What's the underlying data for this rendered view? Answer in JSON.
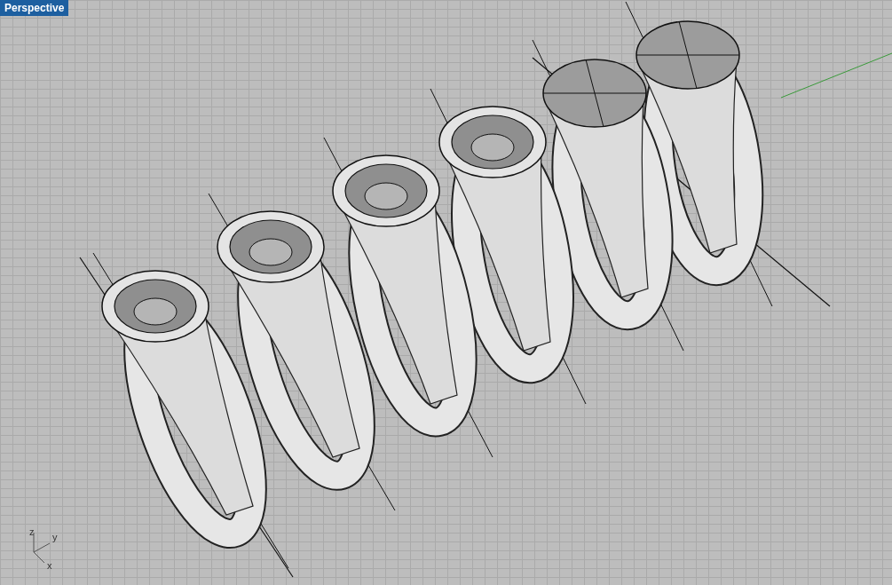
{
  "viewport": {
    "label": "Perspective",
    "selected": true
  },
  "models": [
    {
      "kind": "hollow-top"
    },
    {
      "kind": "hollow-top"
    },
    {
      "kind": "hollow-top"
    },
    {
      "kind": "hollow-top"
    },
    {
      "kind": "flat-top"
    },
    {
      "kind": "flat-top"
    }
  ],
  "axis_labels": [
    "z",
    "y",
    "x"
  ]
}
